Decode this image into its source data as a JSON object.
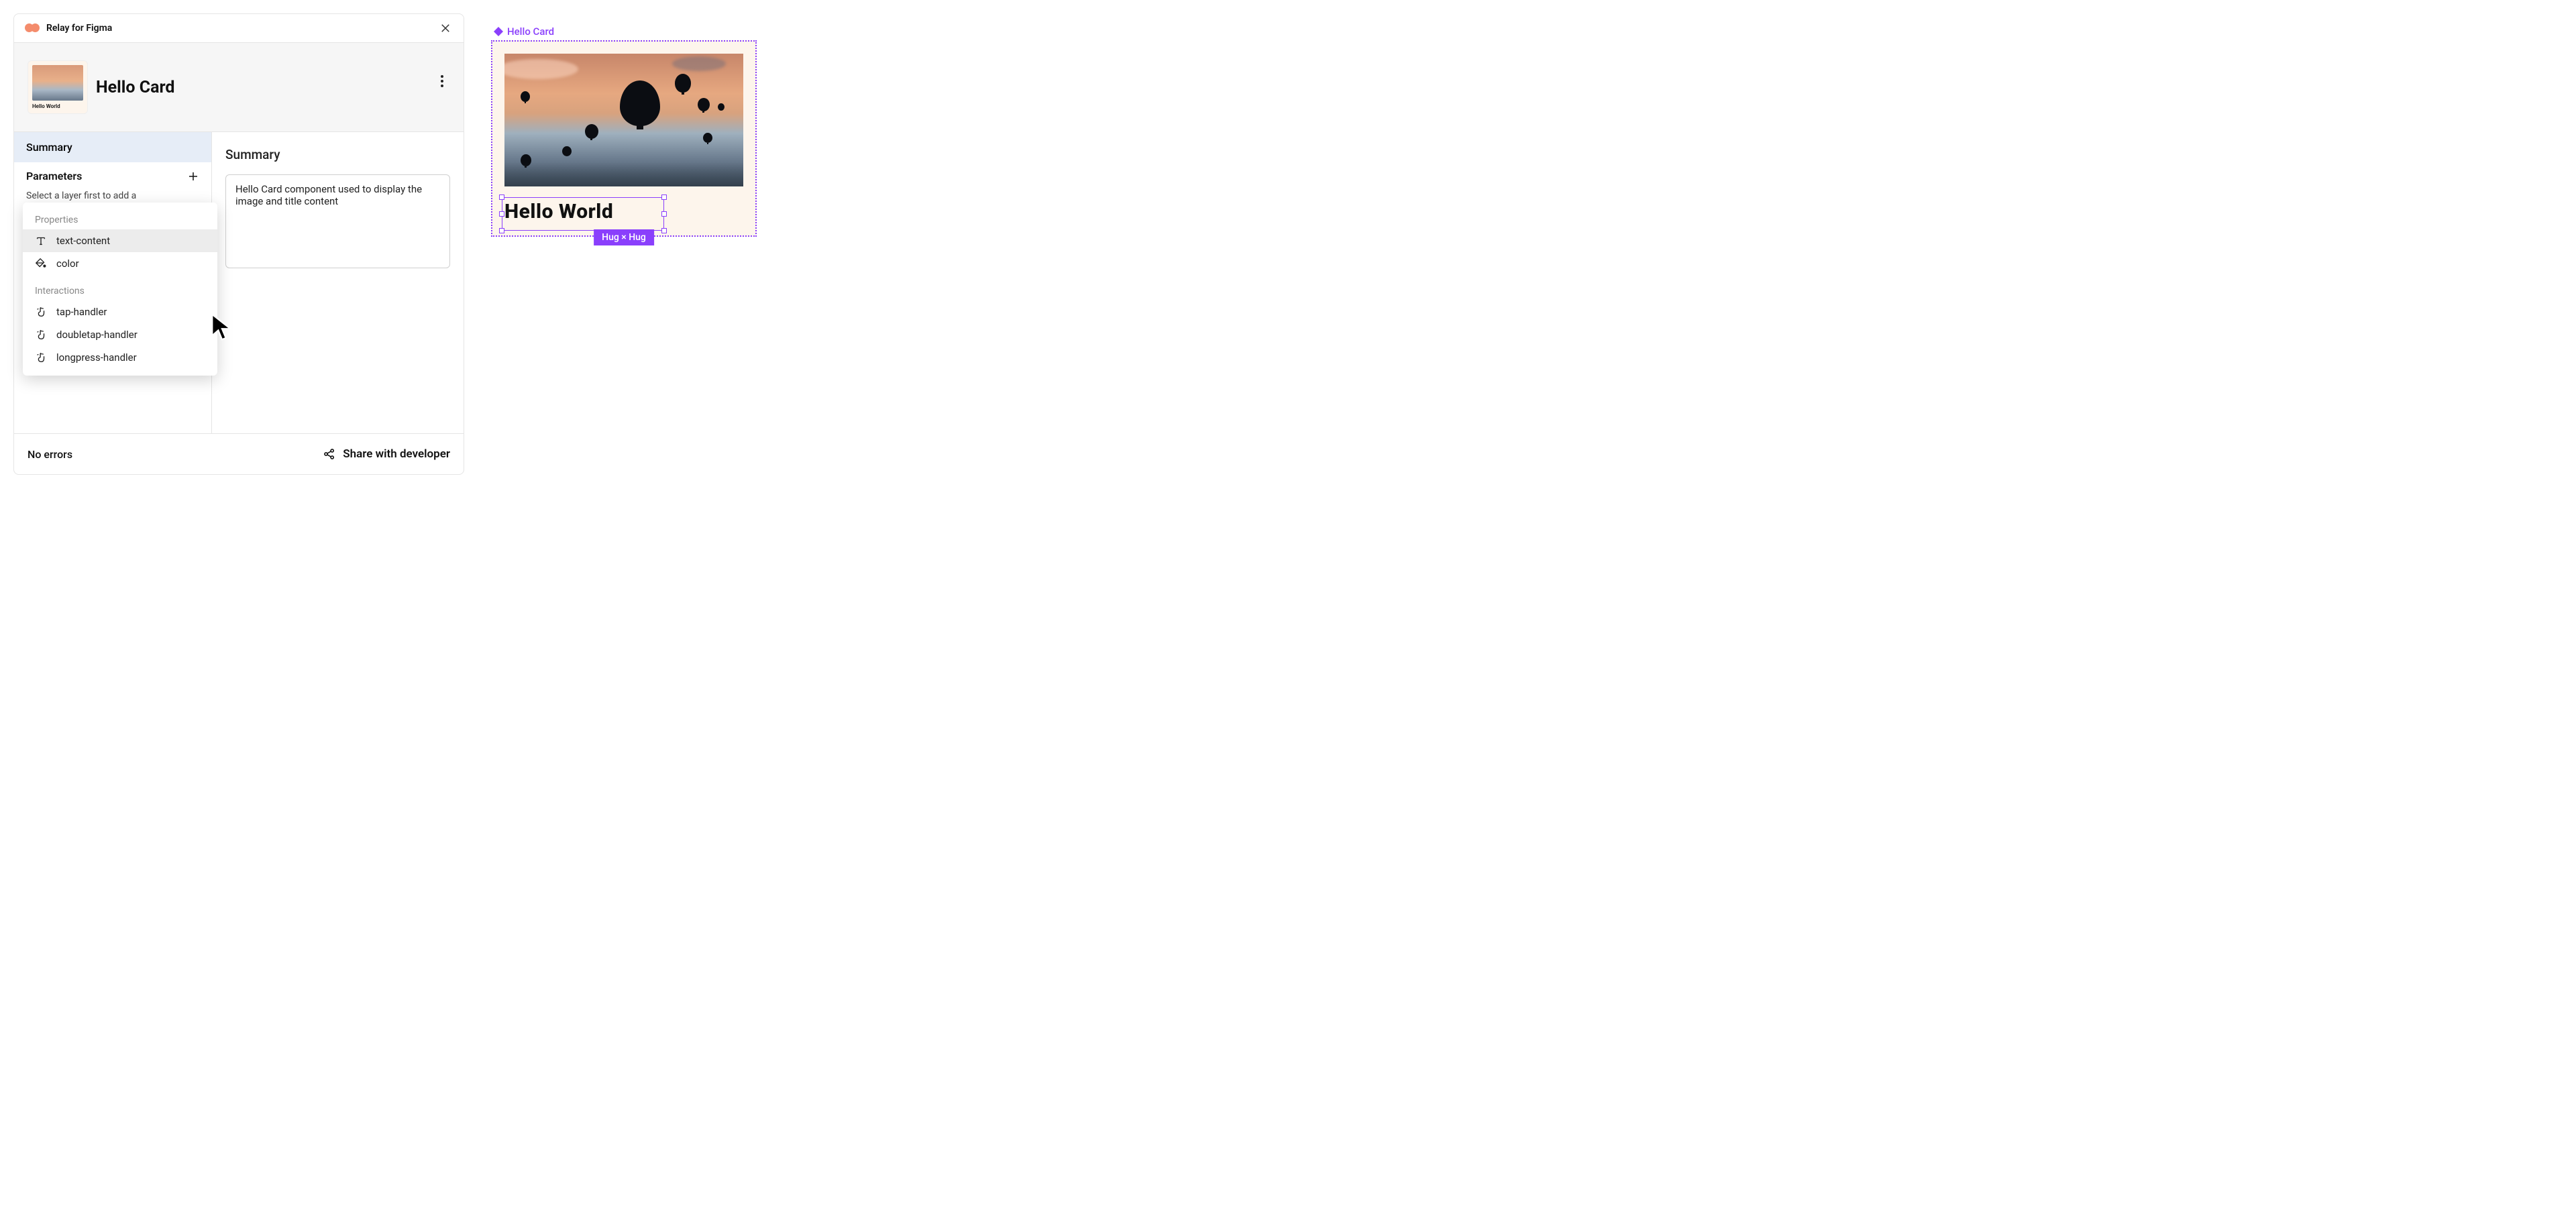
{
  "plugin": {
    "title": "Relay for Figma"
  },
  "component": {
    "name": "Hello Card",
    "thumb_caption": "Hello World"
  },
  "sidebar": {
    "summary_label": "Summary",
    "parameters_label": "Parameters",
    "hint": "Select a layer first to add a"
  },
  "popover": {
    "properties_label": "Properties",
    "properties": [
      {
        "label": "text-content"
      },
      {
        "label": "color"
      }
    ],
    "interactions_label": "Interactions",
    "interactions": [
      {
        "label": "tap-handler"
      },
      {
        "label": "doubletap-handler"
      },
      {
        "label": "longpress-handler"
      }
    ]
  },
  "main": {
    "title": "Summary",
    "summary_text": "Hello Card component used to display the image and title content"
  },
  "footer": {
    "status": "No errors",
    "share_label": "Share with developer"
  },
  "canvas": {
    "frame_label": "Hello Card",
    "text_content": "Hello World",
    "constraint": "Hug × Hug"
  },
  "colors": {
    "accent": "#8a3ffc"
  }
}
